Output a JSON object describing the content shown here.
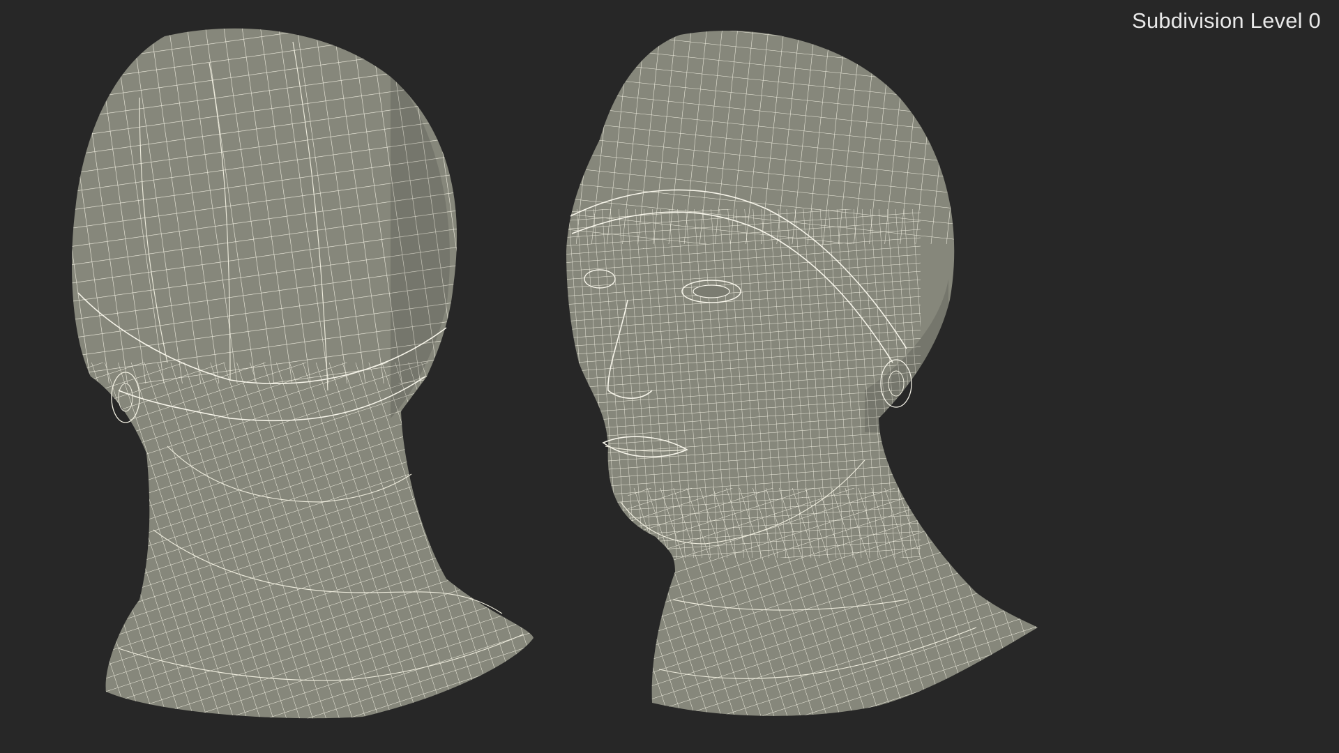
{
  "viewport": {
    "subdivision_label": "Subdivision Level 0"
  },
  "scene": {
    "objects": [
      {
        "name": "head-back-three-quarter",
        "icon": "wireframe-head-icon"
      },
      {
        "name": "head-front-three-quarter",
        "icon": "wireframe-head-icon"
      }
    ],
    "colors": {
      "background": "#272727",
      "mesh": "#86877b",
      "wire": "#f2f0e2"
    }
  }
}
